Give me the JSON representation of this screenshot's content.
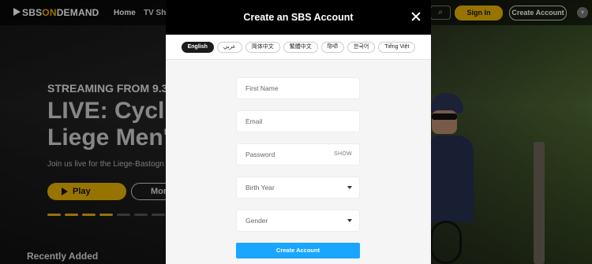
{
  "header": {
    "logo_prefix": "SBS",
    "logo_on": "ON",
    "logo_suffix": "DEMAND",
    "nav": [
      "Home",
      "TV Sho"
    ],
    "search_icon": "search-icon",
    "signin_label": "Sign In",
    "create_label": "Create Account",
    "profile_icon": "chevron-down-icon"
  },
  "hero": {
    "kicker": "STREAMING FROM 9.30",
    "title_line1": "LIVE: Cyclin",
    "title_line2": "Liege Men'",
    "description": "Join us live for the Liege-Bastogn",
    "play_label": "Play",
    "more_label": "Mor",
    "slides_total": 8,
    "slides_active": 4
  },
  "recent": {
    "label": "Recently Added"
  },
  "modal": {
    "title": "Create an SBS Account",
    "languages": [
      "English",
      "عربي",
      "简体中文",
      "繁體中文",
      "हिन्दी",
      "한국어",
      "Tiếng Việt"
    ],
    "active_language": "English",
    "first_name_placeholder": "First Name",
    "email_placeholder": "Email",
    "password_placeholder": "Password",
    "password_show_label": "SHOW",
    "birth_year_placeholder": "Birth Year",
    "gender_placeholder": "Gender",
    "submit_label": "Create Account"
  },
  "colors": {
    "accent_yellow": "#e8b300",
    "submit_blue": "#1aa6ff",
    "modal_header": "#000000",
    "modal_body": "#f5f5f5"
  }
}
